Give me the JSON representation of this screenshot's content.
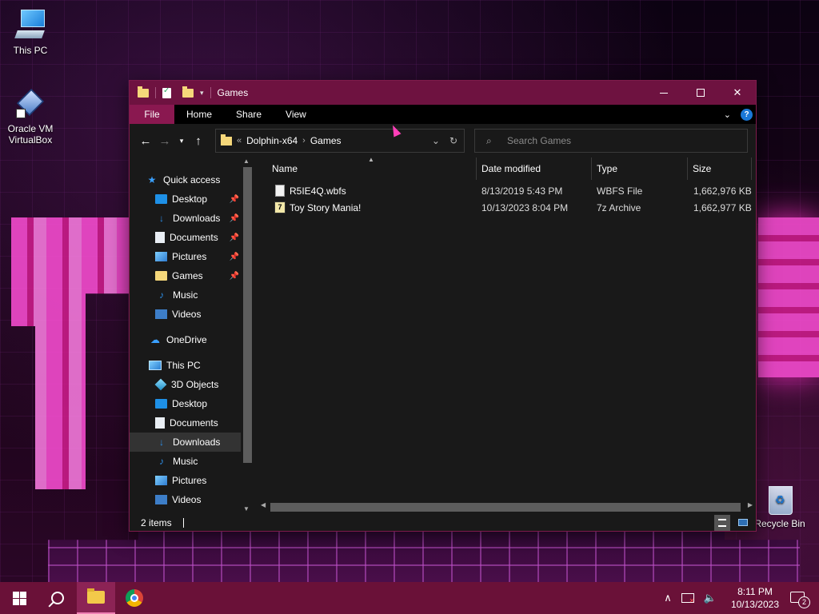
{
  "desktop": {
    "icons": [
      {
        "label": "This PC"
      },
      {
        "label": "Oracle VM VirtualBox"
      },
      {
        "label": "Recycle Bin"
      }
    ]
  },
  "window": {
    "title": "Games",
    "controls": {
      "minimize": "minimize",
      "maximize": "maximize",
      "close": "✕"
    }
  },
  "ribbon": {
    "tabs": [
      "File",
      "Home",
      "Share",
      "View"
    ],
    "help": "?"
  },
  "address": {
    "overflow": "«",
    "crumbs": [
      "Dolphin-x64",
      "Games"
    ],
    "refresh": "↻"
  },
  "search": {
    "placeholder": "Search Games"
  },
  "nav": {
    "quick_access": "Quick access",
    "quick_items": [
      "Desktop",
      "Downloads",
      "Documents",
      "Pictures",
      "Games",
      "Music",
      "Videos"
    ],
    "onedrive": "OneDrive",
    "this_pc": "This PC",
    "pc_items": [
      "3D Objects",
      "Desktop",
      "Documents",
      "Downloads",
      "Music",
      "Pictures",
      "Videos"
    ],
    "selected": "Downloads"
  },
  "files": {
    "columns": [
      "Name",
      "Date modified",
      "Type",
      "Size"
    ],
    "rows": [
      {
        "name": "R5IE4Q.wbfs",
        "date": "8/13/2019 5:43 PM",
        "type": "WBFS File",
        "size": "1,662,976 KB",
        "icon": "file-icon"
      },
      {
        "name": "Toy Story Mania!",
        "date": "10/13/2023 8:04 PM",
        "type": "7z Archive",
        "size": "1,662,977 KB",
        "icon": "archive-icon"
      }
    ]
  },
  "status": {
    "count": "2 items"
  },
  "taskbar": {
    "time": "8:11 PM",
    "date": "10/13/2023",
    "notifications": "2"
  },
  "colors": {
    "accent": "#6e1240",
    "file_tab": "#8a1850",
    "taskbar": "#6a1138"
  }
}
